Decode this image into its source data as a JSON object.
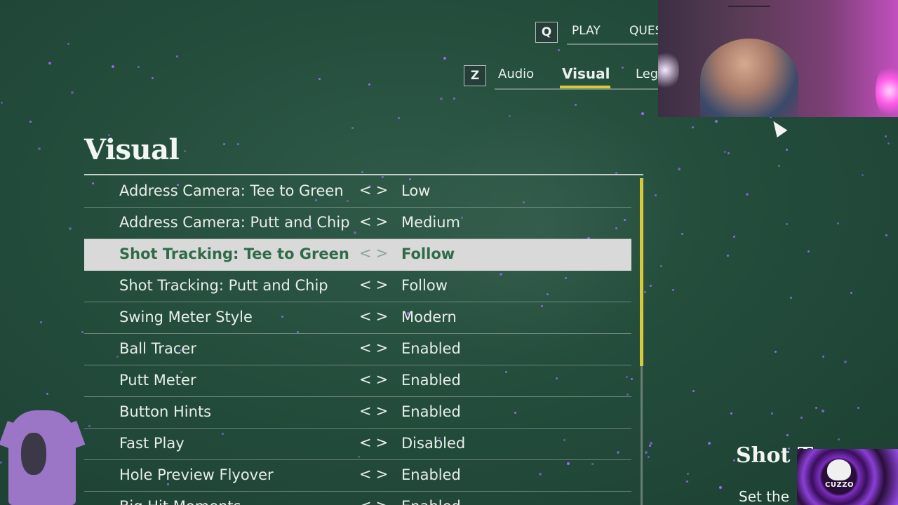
{
  "nav": {
    "top_key": "Q",
    "top_tabs": [
      "PLAY",
      "QUES"
    ],
    "sub_key": "Z",
    "sub_tabs": [
      "Audio",
      "Visual",
      "Lega"
    ],
    "active_sub_tab": "Visual"
  },
  "page": {
    "title": "Visual"
  },
  "settings": [
    {
      "label": "Address Camera: Tee to Green",
      "arrows": "<>",
      "value": "Low"
    },
    {
      "label": "Address Camera: Putt and Chip",
      "arrows": "<>",
      "value": "Medium"
    },
    {
      "label": "Shot Tracking: Tee to Green",
      "arrows": "<>",
      "value": "Follow"
    },
    {
      "label": "Shot Tracking: Putt and Chip",
      "arrows": "<>",
      "value": "Follow"
    },
    {
      "label": "Swing Meter Style",
      "arrows": "<>",
      "value": "Modern"
    },
    {
      "label": "Ball Tracer",
      "arrows": "<>",
      "value": "Enabled"
    },
    {
      "label": "Putt Meter",
      "arrows": "<>",
      "value": "Enabled"
    },
    {
      "label": "Button Hints",
      "arrows": "<>",
      "value": "Enabled"
    },
    {
      "label": "Fast Play",
      "arrows": "<>",
      "value": "Disabled"
    },
    {
      "label": "Hole Preview Flyover",
      "arrows": "<>",
      "value": "Enabled"
    },
    {
      "label": "Big Hit Moments",
      "arrows": "<>",
      "value": "Enabled"
    }
  ],
  "selected_index": 2,
  "description": {
    "title": "Shot T",
    "text": "Set the"
  },
  "logo": {
    "text": "CUZZO"
  },
  "colors": {
    "accent": "#d8c83a",
    "selected_row_bg": "#d9d9d9",
    "selected_text": "#2f6b48",
    "background": "#244d3c",
    "particle": "#a06aff"
  },
  "icons": {
    "cursor": "mouse-pointer-icon",
    "logo": "skull-logo-icon",
    "character": "shirt-graphic-icon"
  }
}
